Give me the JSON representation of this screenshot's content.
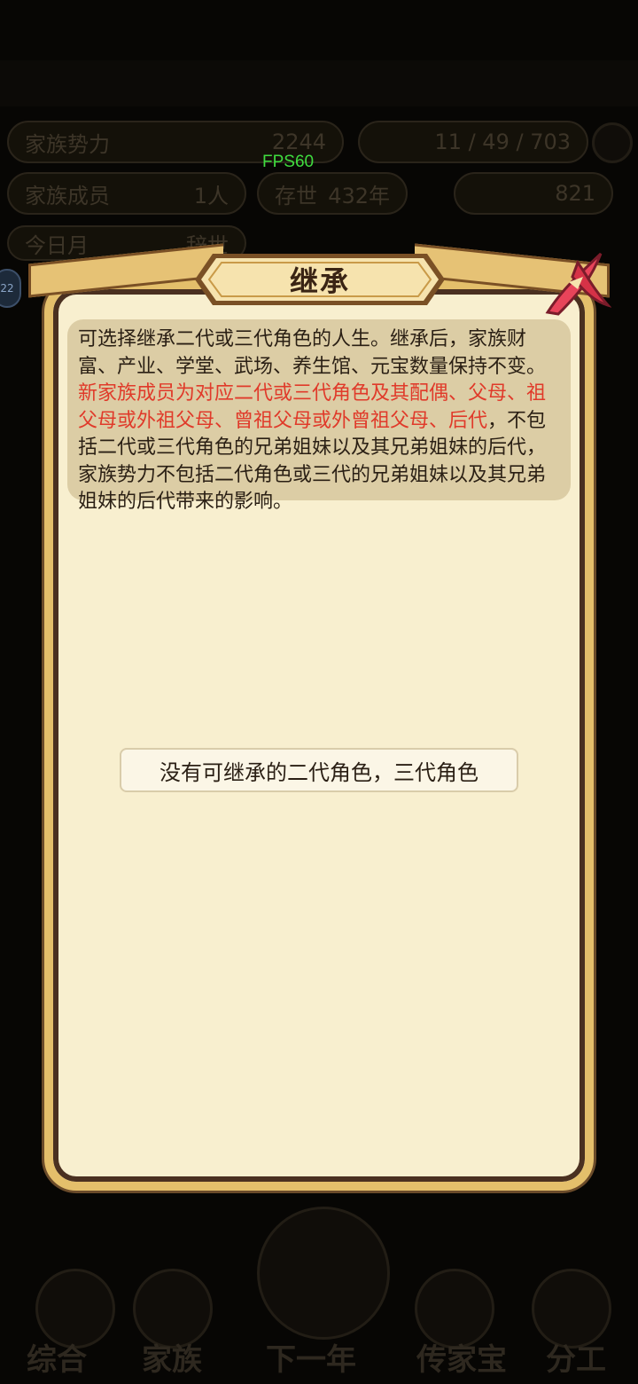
{
  "overlay": {
    "fps_label": "FPS60",
    "side_badge": "22"
  },
  "background": {
    "family_power_label": "家族势力",
    "family_power_value": "2244",
    "resources": "11 / 49 / 703",
    "members_label": "家族成员",
    "members_value": "1人",
    "existence_label": "存世",
    "existence_value": "432年",
    "gold_value": "821",
    "sub_tab_1": "今日月",
    "sub_tab_2": "辞世",
    "nav": [
      "综合",
      "家族",
      "下一年",
      "传家宝",
      "分工"
    ]
  },
  "dialog": {
    "title": "继承",
    "desc_part1": "可选择继承二代或三代角色的人生。继承后，家族财富、产业、学堂、武场、养生馆、元宝数量保持不变。",
    "desc_highlight": "新家族成员为对应二代或三代角色及其配偶、父母、祖父母或外祖父母、曾祖父母或外曾祖父母、后代",
    "desc_part2": "，不包括二代或三代角色的兄弟姐妹以及其兄弟姐妹的后代，家族势力不包括二代角色或三代的兄弟姐妹以及其兄弟姐妹的后代带来的影响。",
    "empty_message": "没有可继承的二代角色，三代角色"
  },
  "colors": {
    "highlight_red": "#e03a2a",
    "frame_gold": "#e4bf6b",
    "parchment": "#f8efcf",
    "fps_green": "#3fdc3f"
  }
}
